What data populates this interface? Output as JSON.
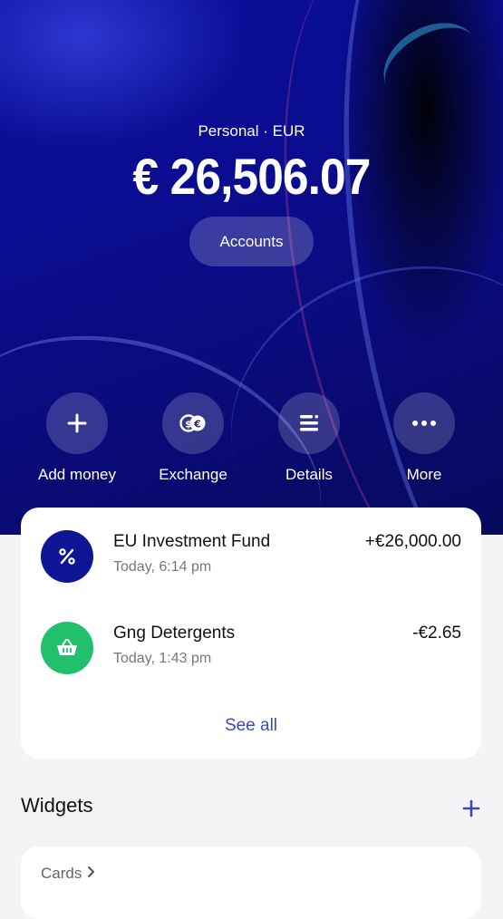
{
  "header": {
    "account_label": "Personal · EUR",
    "balance": "€ 26,506.07",
    "accounts_button": "Accounts"
  },
  "actions": [
    {
      "label": "Add money",
      "icon": "plus-icon"
    },
    {
      "label": "Exchange",
      "icon": "exchange-icon"
    },
    {
      "label": "Details",
      "icon": "details-icon"
    },
    {
      "label": "More",
      "icon": "more-icon"
    }
  ],
  "transactions": [
    {
      "name": "EU Investment Fund",
      "time": "Today, 6:14 pm",
      "amount": "+€26,000.00",
      "icon": "percent-icon",
      "icon_bg": "#0f1696"
    },
    {
      "name": "Gng Detergents",
      "time": "Today, 1:43 pm",
      "amount": "-€2.65",
      "icon": "basket-icon",
      "icon_bg": "#22c06d"
    }
  ],
  "see_all": "See all",
  "widgets": {
    "title": "Widgets",
    "add_icon": "plus-icon",
    "cards_label": "Cards",
    "accent": "#3a4cb8"
  }
}
